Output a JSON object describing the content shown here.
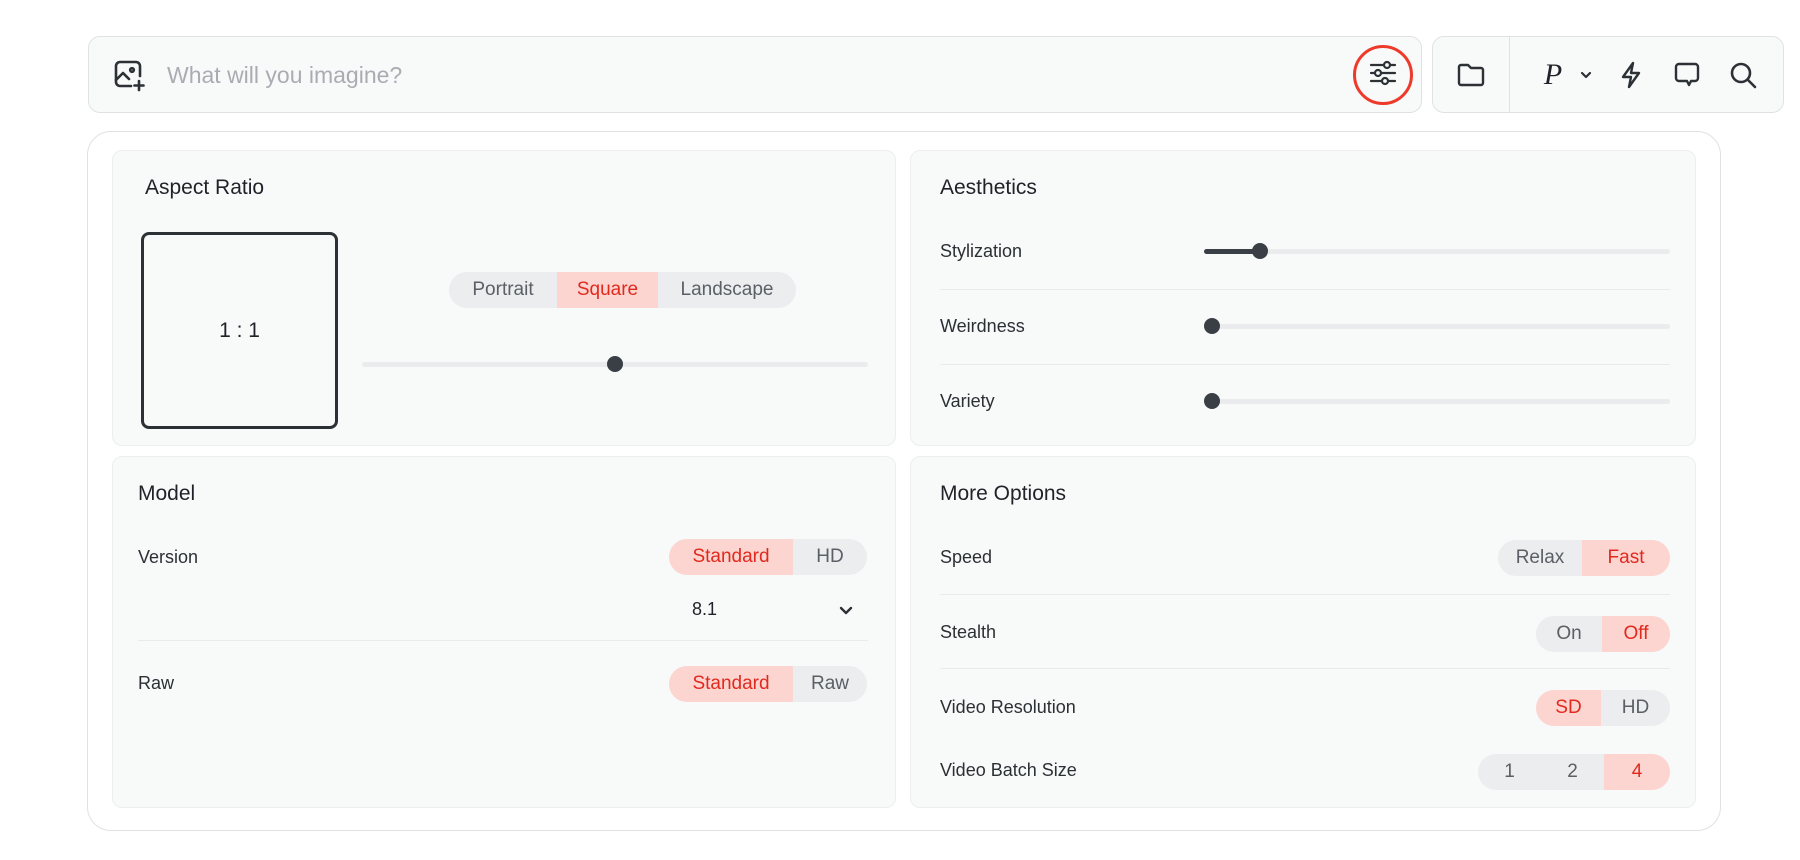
{
  "prompt": {
    "placeholder": "What will you imagine?"
  },
  "toolbar": {
    "personalize_label": "P"
  },
  "aspect_ratio": {
    "title": "Aspect Ratio",
    "preview": "1 : 1",
    "options": [
      "Portrait",
      "Square",
      "Landscape"
    ],
    "selected": "Square",
    "slider_value": 0.5
  },
  "aesthetics": {
    "title": "Aesthetics",
    "rows": [
      {
        "label": "Stylization",
        "value": 0.12
      },
      {
        "label": "Weirdness",
        "value": 0.0
      },
      {
        "label": "Variety",
        "value": 0.0
      }
    ]
  },
  "model": {
    "title": "Model",
    "version_label": "Version",
    "version_options": [
      "Standard",
      "HD"
    ],
    "version_selected": "Standard",
    "version_number": "8.1",
    "raw_label": "Raw",
    "raw_options": [
      "Standard",
      "Raw"
    ],
    "raw_selected": "Standard"
  },
  "more_options": {
    "title": "More Options",
    "speed_label": "Speed",
    "speed_options": [
      "Relax",
      "Fast"
    ],
    "speed_selected": "Fast",
    "stealth_label": "Stealth",
    "stealth_options": [
      "On",
      "Off"
    ],
    "stealth_selected": "Off",
    "video_resolution_label": "Video Resolution",
    "video_resolution_options": [
      "SD",
      "HD"
    ],
    "video_resolution_selected": "SD",
    "video_batch_label": "Video Batch Size",
    "video_batch_options": [
      "1",
      "2",
      "4"
    ],
    "video_batch_selected": "4"
  },
  "colors": {
    "accent": "#e12a1e",
    "accent_bg": "#fcd5d1",
    "highlight_ring": "#ee3a2a"
  }
}
